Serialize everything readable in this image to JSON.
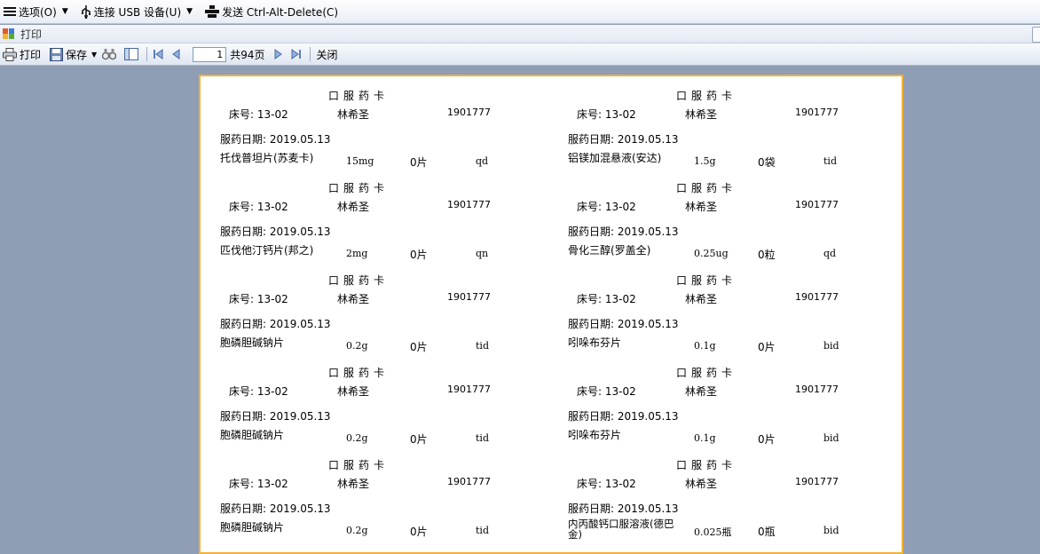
{
  "menubar": {
    "options_label": "选项(O)",
    "usb_label": "连接 USB 设备(U)",
    "cad_label": "发送 Ctrl-Alt-Delete(C)"
  },
  "window": {
    "title": "打印"
  },
  "toolbar": {
    "print_label": "打印",
    "save_label": "保存",
    "page_current": "1",
    "page_total": "共94页",
    "close_label": "关闭"
  },
  "cards": [
    {
      "title": "口服药卡",
      "bed": "床号: 13-02",
      "name": "林希圣",
      "id": "1901777",
      "date": "服药日期: 2019.05.13",
      "drug": "托伐普坦片(苏麦卡)",
      "dose": "15mg",
      "qty": "0片",
      "freq": "qd"
    },
    {
      "title": "口服药卡",
      "bed": "床号: 13-02",
      "name": "林希圣",
      "id": "1901777",
      "date": "服药日期: 2019.05.13",
      "drug": "铝镁加混悬液(安达)",
      "dose": "1.5g",
      "qty": "0袋",
      "freq": "tid"
    },
    {
      "title": "口服药卡",
      "bed": "床号: 13-02",
      "name": "林希圣",
      "id": "1901777",
      "date": "服药日期: 2019.05.13",
      "drug": "匹伐他汀钙片(邦之)",
      "dose": "2mg",
      "qty": "0片",
      "freq": "qn"
    },
    {
      "title": "口服药卡",
      "bed": "床号: 13-02",
      "name": "林希圣",
      "id": "1901777",
      "date": "服药日期: 2019.05.13",
      "drug": "骨化三醇(罗盖全)",
      "dose": "0.25ug",
      "qty": "0粒",
      "freq": "qd"
    },
    {
      "title": "口服药卡",
      "bed": "床号: 13-02",
      "name": "林希圣",
      "id": "1901777",
      "date": "服药日期: 2019.05.13",
      "drug": "胞磷胆碱钠片",
      "dose": "0.2g",
      "qty": "0片",
      "freq": "tid"
    },
    {
      "title": "口服药卡",
      "bed": "床号: 13-02",
      "name": "林希圣",
      "id": "1901777",
      "date": "服药日期: 2019.05.13",
      "drug": "吲哚布芬片",
      "dose": "0.1g",
      "qty": "0片",
      "freq": "bid"
    },
    {
      "title": "口服药卡",
      "bed": "床号: 13-02",
      "name": "林希圣",
      "id": "1901777",
      "date": "服药日期: 2019.05.13",
      "drug": "胞磷胆碱钠片",
      "dose": "0.2g",
      "qty": "0片",
      "freq": "tid"
    },
    {
      "title": "口服药卡",
      "bed": "床号: 13-02",
      "name": "林希圣",
      "id": "1901777",
      "date": "服药日期: 2019.05.13",
      "drug": "吲哚布芬片",
      "dose": "0.1g",
      "qty": "0片",
      "freq": "bid"
    },
    {
      "title": "口服药卡",
      "bed": "床号: 13-02",
      "name": "林希圣",
      "id": "1901777",
      "date": "服药日期: 2019.05.13",
      "drug": "胞磷胆碱钠片",
      "dose": "0.2g",
      "qty": "0片",
      "freq": "tid"
    },
    {
      "title": "口服药卡",
      "bed": "床号: 13-02",
      "name": "林希圣",
      "id": "1901777",
      "date": "服药日期: 2019.05.13",
      "drug": "内丙酸钙口服溶液(德巴金)",
      "dose": "0.025瓶",
      "qty": "0瓶",
      "freq": "bid"
    }
  ]
}
